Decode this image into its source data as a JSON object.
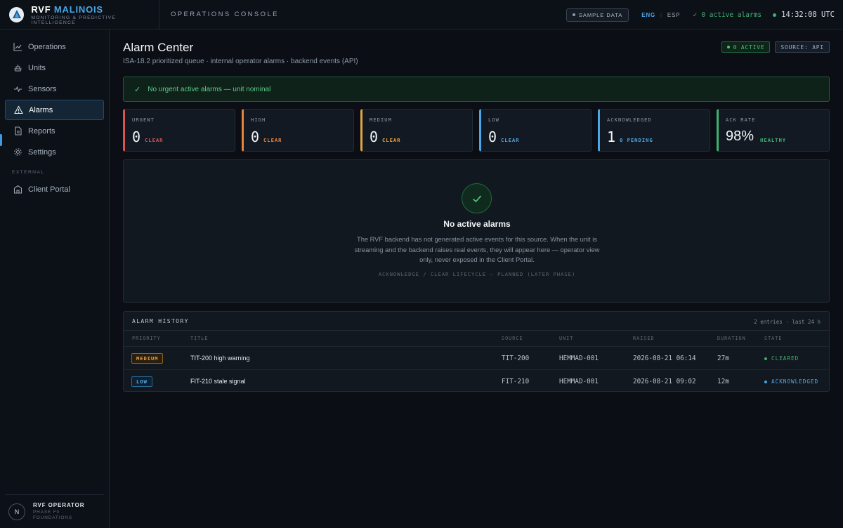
{
  "brand": {
    "name_primary": "RVF",
    "name_accent": "MALINOIS",
    "tagline": "MONITORING & PREDICTIVE INTELLIGENCE",
    "console": "OPERATIONS CONSOLE",
    "accent_color": "#4aa6e6"
  },
  "topbar": {
    "sample_badge": "SAMPLE DATA",
    "lang_active": "ENG",
    "lang_sep": "|",
    "lang_other": "ESP",
    "alarm_status": "0 active alarms",
    "clock": "14:32:08 UTC",
    "status_color": "#3fb16f"
  },
  "sidebar": {
    "items": [
      {
        "label": "Operations",
        "icon": "line-chart-icon"
      },
      {
        "label": "Units",
        "icon": "units-icon"
      },
      {
        "label": "Sensors",
        "icon": "pulse-icon"
      },
      {
        "label": "Alarms",
        "icon": "warning-triangle-icon"
      },
      {
        "label": "Reports",
        "icon": "document-icon"
      },
      {
        "label": "Settings",
        "icon": "gear-icon"
      }
    ],
    "external_label": "EXTERNAL",
    "external_items": [
      {
        "label": "Client Portal",
        "icon": "building-icon"
      }
    ],
    "active": "Alarms",
    "user": {
      "initial": "N",
      "name": "RVF OPERATOR",
      "role_line1": "PHASE F0 ·",
      "role_line2": "FOUNDATIONS"
    }
  },
  "page": {
    "title": "Alarm Center",
    "subtitle": "ISA-18.2 prioritized queue · internal operator alarms · backend events (API)",
    "badge_active": "0 ACTIVE",
    "badge_source": "SOURCE: API",
    "nominal_banner": "No urgent active alarms — unit nominal"
  },
  "kpis": [
    {
      "label": "URGENT",
      "value": "0",
      "status": "CLEAR",
      "color": "#d9534f"
    },
    {
      "label": "HIGH",
      "value": "0",
      "status": "CLEAR",
      "color": "#e8833a"
    },
    {
      "label": "MEDIUM",
      "value": "0",
      "status": "CLEAR",
      "color": "#e2a245"
    },
    {
      "label": "LOW",
      "value": "0",
      "status": "CLEAR",
      "color": "#4aa6e6"
    },
    {
      "label": "ACKNOWLEDGED",
      "value": "1",
      "status": "0 PENDING",
      "color": "#4aa6e6"
    },
    {
      "label": "ACK RATE",
      "value": "98%",
      "status": "HEALTHY",
      "color": "#3fb16f"
    }
  ],
  "empty_state": {
    "title": "No active alarms",
    "description": "The RVF backend has not generated active events for this source. When the unit is streaming and the backend raises real events, they will appear here — operator view only, never exposed in the Client Portal.",
    "note": "ACKNOWLEDGE / CLEAR LIFECYCLE — PLANNED (LATER PHASE)"
  },
  "history": {
    "title": "ALARM HISTORY",
    "meta": "2 entries · last 24 h",
    "columns": [
      "PRIORITY",
      "TITLE",
      "SOURCE",
      "UNIT",
      "RAISED",
      "DURATION",
      "STATE"
    ],
    "rows": [
      {
        "priority": "MEDIUM",
        "title": "TIT-200 high warning",
        "source": "TIT-200",
        "unit": "HEMMAD-001",
        "raised": "2026-08-21 06:14",
        "duration": "27m",
        "state": "CLEARED",
        "state_color": "#3fb16f"
      },
      {
        "priority": "LOW",
        "title": "FIT-210 stale signal",
        "source": "FIT-210",
        "unit": "HEMMAD-001",
        "raised": "2026-08-21 09:02",
        "duration": "12m",
        "state": "ACKNOWLEDGED",
        "state_color": "#4aa6e6"
      }
    ]
  }
}
